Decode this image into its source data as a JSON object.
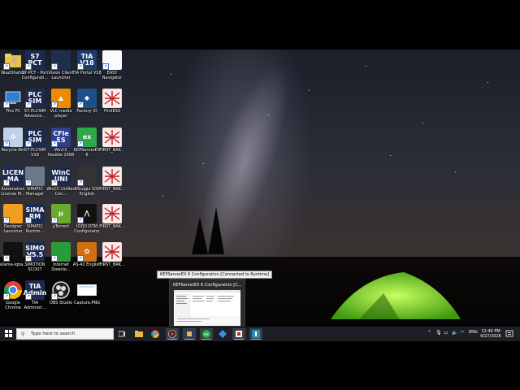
{
  "desktop": {
    "icons": [
      {
        "label": "NiaziShahid",
        "icon": "user-folder-icon",
        "glyph": "",
        "color": "#e8c04a"
      },
      {
        "label": "S7-PCT - Port Configurati...",
        "icon": "s7-pct-icon",
        "glyph": "S7 PCT",
        "color": "#1a2a50"
      },
      {
        "label": "Vision Client Launcher",
        "icon": "vision-client-icon",
        "glyph": "",
        "color": "#1f2f4a"
      },
      {
        "label": "TIA Portal V18",
        "icon": "tia-portal-icon",
        "glyph": "TIA V18",
        "color": "#1d3c6e"
      },
      {
        "label": "EASY Navigator",
        "icon": "easy-navigator-icon",
        "glyph": "✲",
        "color": "#fafafa"
      },
      {
        "label": "This PC",
        "icon": "this-pc-icon",
        "glyph": "",
        "color": "#2e7fd0"
      },
      {
        "label": "S7-PLCSIM Advance...",
        "icon": "plcsim-advanced-icon",
        "glyph": "PLC SIM",
        "color": "#1a2a50"
      },
      {
        "label": "VLC media player",
        "icon": "vlc-icon",
        "glyph": "▲",
        "color": "#f08a00"
      },
      {
        "label": "Factory IO",
        "icon": "factory-io-icon",
        "glyph": "◆",
        "color": "#1d4f8a"
      },
      {
        "label": "FirstESS",
        "icon": "ess-diagram-icon",
        "glyph": "",
        "color": "#f4e0e0"
      },
      {
        "label": "Recycle Bin",
        "icon": "recycle-bin-icon",
        "glyph": "♻",
        "color": "#bfd2e6"
      },
      {
        "label": "S7-PLCSIM V18",
        "icon": "plcsim-icon",
        "glyph": "PLC SIM",
        "color": "#1a2a50"
      },
      {
        "label": "WinCC flexible 2008",
        "icon": "wincc-flexible-icon",
        "glyph": "CFle ES",
        "color": "#2d3f8a"
      },
      {
        "label": "KEPServerEX 6 Configurati...",
        "icon": "kepserver-icon",
        "glyph": "ex",
        "color": "#2ea84a"
      },
      {
        "label": "FIRST_BAK...",
        "icon": "ess-diagram-icon",
        "glyph": "",
        "color": "#f4e0e0"
      },
      {
        "label": "Automation License M...",
        "icon": "license-manager-icon",
        "glyph": "LICEN MA",
        "color": "#1a2a50"
      },
      {
        "label": "SIMATIC Manager",
        "icon": "simatic-manager-icon",
        "glyph": "",
        "color": "#6a7a8a"
      },
      {
        "label": "WinCC Unified Con...",
        "icon": "wincc-unified-icon",
        "glyph": "WinC UNI",
        "color": "#1a2a50"
      },
      {
        "label": "RSLogix 500 English",
        "icon": "rslogix-icon",
        "glyph": "",
        "color": "#333"
      },
      {
        "label": "FIRST_BAK...",
        "icon": "ess-diagram-icon",
        "glyph": "",
        "color": "#f4e0e0"
      },
      {
        "label": "Designer Launcher",
        "icon": "designer-launcher-icon",
        "glyph": "",
        "color": "#f0a020"
      },
      {
        "label": "SIMATIC Runtim...",
        "icon": "simatic-runtime-icon",
        "glyph": "SIMA RM",
        "color": "#1a2a50"
      },
      {
        "label": "µTorrent",
        "icon": "utorrent-icon",
        "glyph": "µ",
        "color": "#6aa830"
      },
      {
        "label": "IODD DTM Configurator",
        "icon": "iodd-icon",
        "glyph": "⋀",
        "color": "#111"
      },
      {
        "label": "FIRST_BAK...",
        "icon": "ess-diagram-icon",
        "glyph": "",
        "color": "#f4e0e0"
      },
      {
        "label": "allama-iqba...",
        "icon": "ink-file-icon",
        "glyph": "",
        "color": "#111"
      },
      {
        "label": "SIMOTION SCOUT",
        "icon": "simotion-icon",
        "glyph": "SIMO V5.5",
        "color": "#1a2a50"
      },
      {
        "label": "Internet Downlo...",
        "icon": "idm-icon",
        "glyph": "",
        "color": "#2a9a3a"
      },
      {
        "label": "AS-42 English",
        "icon": "as42-icon",
        "glyph": "✿",
        "color": "#d07010"
      },
      {
        "label": "FIRST_BAK...",
        "icon": "ess-diagram-icon",
        "glyph": "",
        "color": "#f4e0e0"
      },
      {
        "label": "Google Chrome",
        "icon": "chrome-icon",
        "glyph": "",
        "color": "#fff"
      },
      {
        "label": "TIA Administ...",
        "icon": "tia-admin-icon",
        "glyph": "TIA Admin",
        "color": "#1a2a50"
      },
      {
        "label": "OBS Studio",
        "icon": "obs-icon",
        "glyph": "",
        "color": "#222"
      },
      {
        "label": "Capture.PNG",
        "icon": "png-file-icon",
        "glyph": "",
        "color": "#eee"
      }
    ]
  },
  "tooltip": "KEPServerEX 6 Configuration [Connected to Runtime]",
  "preview": {
    "title": "KEPServerEX 6 Configuration [C..."
  },
  "taskbar": {
    "search_placeholder": "Type here to search",
    "tray_lang": "ENG",
    "clock_time": "12:40 PM",
    "clock_date": "9/27/2026"
  }
}
